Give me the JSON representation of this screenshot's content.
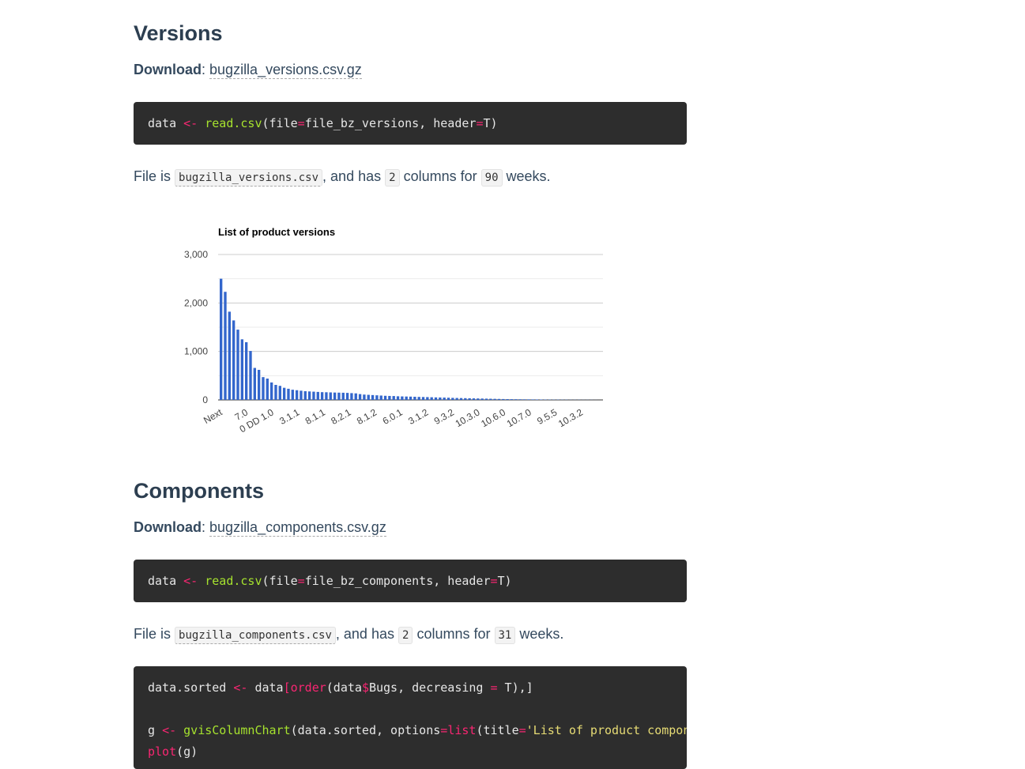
{
  "versions": {
    "heading": "Versions",
    "download_label": "Download",
    "download_sep": ":",
    "download_link": "bugzilla_versions.csv.gz",
    "code": {
      "var": "data",
      "assign": "<-",
      "fn": "read.csv",
      "open": "(file",
      "eq": "=",
      "arg": "file_bz_versions, header",
      "eq2": "=",
      "close": "T)"
    },
    "info": {
      "prefix": "File is",
      "file": "bugzilla_versions.csv",
      "mid1": ", and has",
      "cols": "2",
      "mid2": "columns for",
      "weeks": "90",
      "suffix": "weeks."
    }
  },
  "chart_data": {
    "type": "bar",
    "title": "List of product versions",
    "ylim": [
      0,
      3000
    ],
    "y_ticks": [
      "0",
      "1,000",
      "2,000",
      "3,000"
    ],
    "grid": true,
    "color": "#3366cc",
    "x_tick_labels": [
      "Next",
      "7.0",
      "0 DD 1.0",
      "3.1.1",
      "8.1.1",
      "8.2.1",
      "8.1.2",
      "6.0.1",
      "3.1.2",
      "9.3.2",
      "10.3.0",
      "10.6.0",
      "10.7.0",
      "9.5.5",
      "10.3.2"
    ],
    "values": [
      2500,
      2230,
      1820,
      1640,
      1450,
      1250,
      1190,
      1010,
      660,
      620,
      470,
      440,
      360,
      310,
      290,
      250,
      230,
      210,
      200,
      190,
      180,
      175,
      170,
      165,
      160,
      158,
      155,
      152,
      150,
      148,
      145,
      140,
      135,
      120,
      110,
      105,
      100,
      95,
      90,
      85,
      82,
      80,
      75,
      72,
      70,
      68,
      65,
      62,
      60,
      58,
      55,
      52,
      50,
      48,
      45,
      42,
      40,
      38,
      36,
      34,
      32,
      30,
      28,
      26,
      24,
      22,
      20,
      18,
      16,
      15,
      14,
      13,
      12,
      11,
      10,
      9,
      8,
      7,
      6,
      5,
      5,
      4,
      4,
      3,
      3,
      3,
      2,
      2,
      2,
      1
    ]
  },
  "components": {
    "heading": "Components",
    "download_label": "Download",
    "download_sep": ":",
    "download_link": "bugzilla_components.csv.gz",
    "code": {
      "var": "data",
      "assign": "<-",
      "fn": "read.csv",
      "open": "(file",
      "eq": "=",
      "arg": "file_bz_components, header",
      "eq2": "=",
      "close": "T)"
    },
    "info": {
      "prefix": "File is",
      "file": "bugzilla_components.csv",
      "mid1": ", and has",
      "cols": "2",
      "mid2": "columns for",
      "weeks": "31",
      "suffix": "weeks."
    },
    "code2": {
      "l1_a": "data.sorted ",
      "l1_op": "<-",
      "l1_b": " data",
      "l1_br": "[",
      "l1_fn": "order",
      "l1_c": "(data",
      "l1_dollar": "$",
      "l1_d": "Bugs, decreasing ",
      "l1_eq": "=",
      "l1_e": " T),]",
      "l2_a": "g ",
      "l2_op": "<-",
      "l2_sp": " ",
      "l2_fn": "gvisColumnChart",
      "l2_b": "(data.sorted, options",
      "l2_eq": "=",
      "l2_fn2": "list",
      "l2_c": "(title",
      "l2_eq2": "=",
      "l2_str": "'List of product components'",
      "l3_fn": "plot",
      "l3_a": "(g)"
    }
  }
}
